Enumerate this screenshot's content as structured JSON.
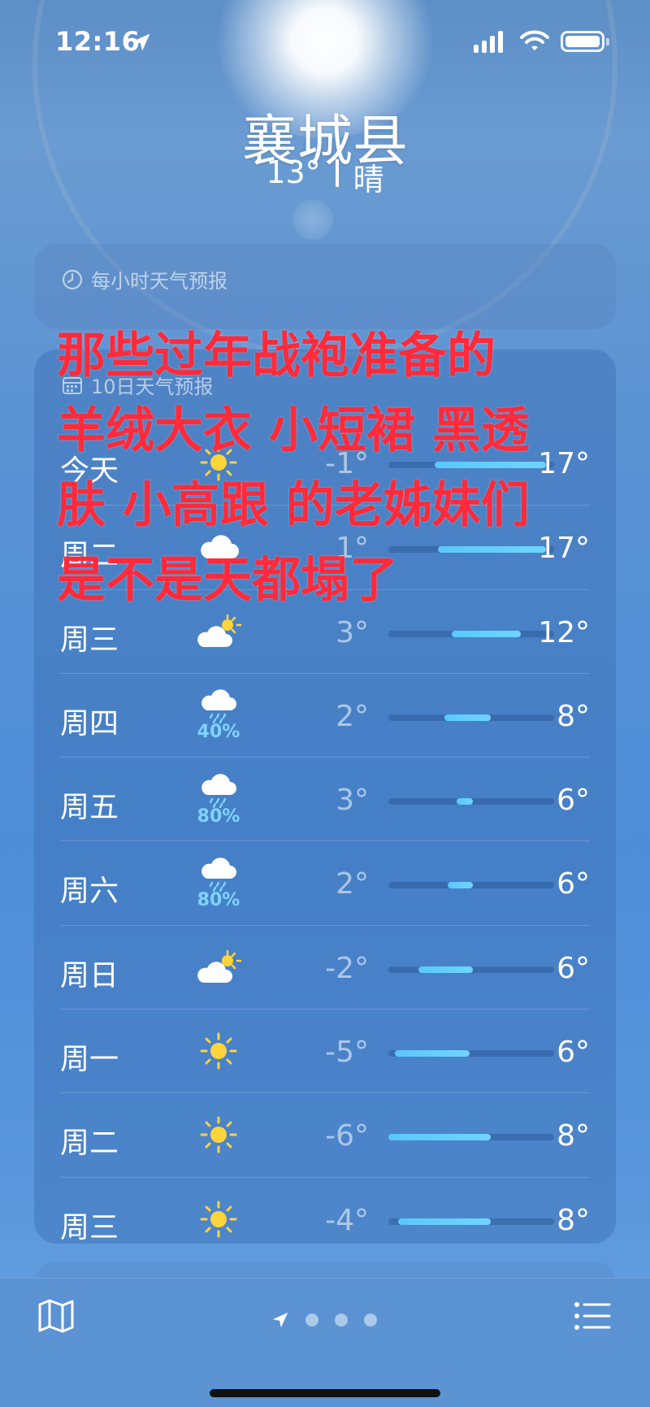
{
  "status": {
    "time": "12:16"
  },
  "header": {
    "city": "襄城县",
    "temp": "13°",
    "condition": "晴"
  },
  "hourly": {
    "title": "每小时天气预报"
  },
  "daily": {
    "title": "10日天气预报",
    "rows": [
      {
        "day": "今天",
        "icon": "sun-icon",
        "pct": "",
        "lo": "-1°",
        "hi": "17°",
        "range": [
          0.28,
          0.95
        ]
      },
      {
        "day": "周二",
        "icon": "cloud-icon",
        "pct": "",
        "lo": "1°",
        "hi": "17°",
        "range": [
          0.3,
          0.95
        ]
      },
      {
        "day": "周三",
        "icon": "partly-cloudy-icon",
        "pct": "",
        "lo": "3°",
        "hi": "12°",
        "range": [
          0.38,
          0.8
        ]
      },
      {
        "day": "周四",
        "icon": "rain-icon",
        "pct": "40%",
        "lo": "2°",
        "hi": "8°",
        "range": [
          0.34,
          0.62
        ]
      },
      {
        "day": "周五",
        "icon": "rain-icon",
        "pct": "80%",
        "lo": "3°",
        "hi": "6°",
        "range": [
          0.41,
          0.51
        ]
      },
      {
        "day": "周六",
        "icon": "rain-icon",
        "pct": "80%",
        "lo": "2°",
        "hi": "6°",
        "range": [
          0.36,
          0.51
        ]
      },
      {
        "day": "周日",
        "icon": "partly-cloudy-icon",
        "pct": "",
        "lo": "-2°",
        "hi": "6°",
        "range": [
          0.18,
          0.51
        ]
      },
      {
        "day": "周一",
        "icon": "sun-icon",
        "pct": "",
        "lo": "-5°",
        "hi": "6°",
        "range": [
          0.04,
          0.49
        ]
      },
      {
        "day": "周二",
        "icon": "sun-icon",
        "pct": "",
        "lo": "-6°",
        "hi": "8°",
        "range": [
          0.0,
          0.62
        ]
      },
      {
        "day": "周三",
        "icon": "sun-icon",
        "pct": "",
        "lo": "-4°",
        "hi": "8°",
        "range": [
          0.06,
          0.62
        ]
      }
    ]
  },
  "overlay_text": [
    "那些过年战袍准备的",
    "羊绒大衣 小短裙 黑透",
    "肤 小高跟 的老姊妹们",
    "是不是天都塌了"
  ],
  "colors": {
    "overlay_red": "#ff2a3a",
    "bar_blue": "#5ac8fa",
    "precip_blue": "#7fd3ff"
  }
}
